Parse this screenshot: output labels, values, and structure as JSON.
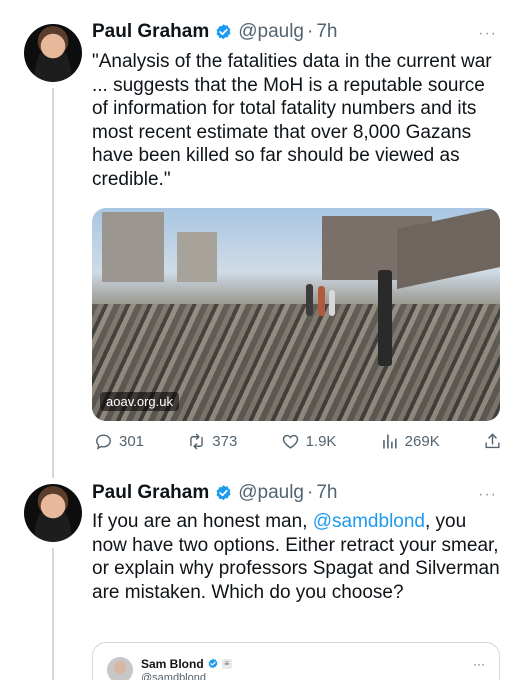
{
  "colors": {
    "link": "#1d9bf0",
    "verified": "#1d9bf0",
    "secondary": "#536471",
    "text": "#0f1419"
  },
  "tweet1": {
    "name": "Paul Graham",
    "handle": "@paulg",
    "separator": "·",
    "time": "7h",
    "more": "···",
    "text": "\"Analysis of the fatalities data in the current war ... suggests that the MoH is a reputable source of information for total fatality numbers and its most recent estimate that over 8,000 Gazans have been killed so far should be viewed as credible.\"",
    "media_source": "aoav.org.uk",
    "replies": "301",
    "retweets": "373",
    "likes": "1.9K",
    "views": "269K",
    "icons": {
      "reply": "reply-icon",
      "retweet": "retweet-icon",
      "like": "heart-icon",
      "views": "views-icon",
      "share": "share-icon"
    }
  },
  "tweet2": {
    "name": "Paul Graham",
    "handle": "@paulg",
    "separator": "·",
    "time": "7h",
    "more": "···",
    "text_before": "If you are an honest man, ",
    "mention": "@samdblond",
    "text_after": ", you now have two options. Either retract your smear, or explain why professors Spagat and Silverman are mistaken. Which do you choose?",
    "quote": {
      "name": "Sam Blond",
      "handle": "@samdblond",
      "badge": "≡",
      "more": "···"
    }
  }
}
